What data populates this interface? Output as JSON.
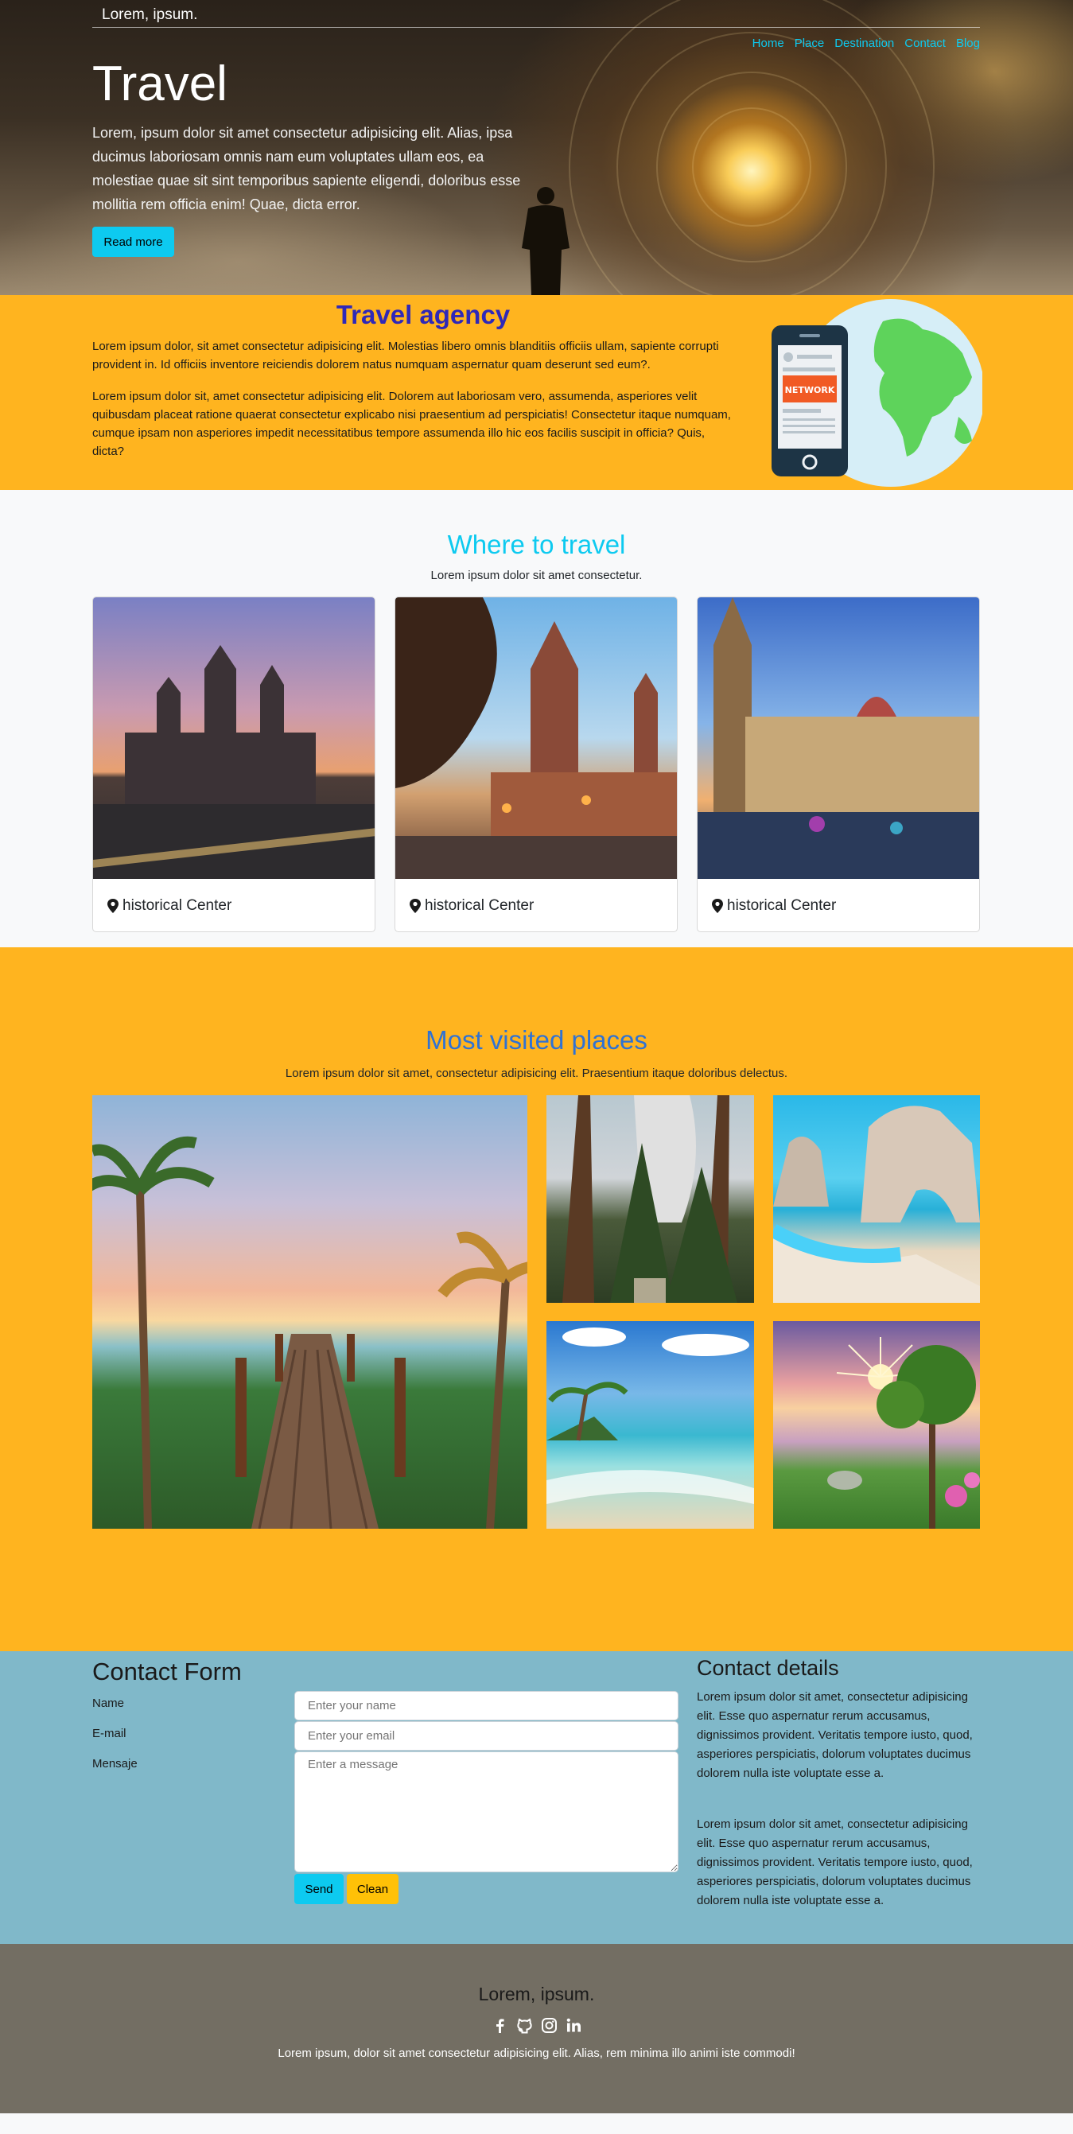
{
  "header": {
    "brand": "Lorem, ipsum.",
    "nav": [
      "Home",
      "Place",
      "Destination",
      "Contact",
      "Blog"
    ]
  },
  "hero": {
    "title": "Travel",
    "text": "Lorem, ipsum dolor sit amet consectetur adipisicing elit. Alias, ipsa ducimus laboriosam omnis nam eum voluptates ullam eos, ea molestiae quae sit sint temporibus sapiente eligendi, doloribus esse mollitia rem officia enim! Quae, dicta error.",
    "button": "Read more"
  },
  "agency": {
    "title": "Travel agency",
    "p1": "Lorem ipsum dolor, sit amet consectetur adipisicing elit. Molestias libero omnis blanditiis officiis ullam, sapiente corrupti provident in. Id officiis inventore reiciendis dolorem natus numquam aspernatur quam deserunt sed eum?.",
    "p2": "Lorem ipsum dolor sit, amet consectetur adipisicing elit. Dolorem aut laboriosam vero, assumenda, asperiores velit quibusdam placeat ratione quaerat consectetur explicabo nisi praesentium ad perspiciatis! Consectetur itaque numquam, cumque ipsam non asperiores impedit necessitatibus tempore assumenda illo hic eos facilis suscipit in officia? Quis, dicta?",
    "image_label": "NETWORK"
  },
  "where": {
    "title": "Where to travel",
    "subtitle": "Lorem ipsum dolor sit amet consectetur.",
    "cards": [
      {
        "caption": "historical Center"
      },
      {
        "caption": "historical Center"
      },
      {
        "caption": "historical Center"
      }
    ]
  },
  "most": {
    "title": "Most visited places",
    "subtitle": "Lorem ipsum dolor sit amet, consectetur adipisicing elit. Praesentium itaque doloribus delectus."
  },
  "contact": {
    "title": "Contact Form",
    "name_label": "Name",
    "email_label": "E-mail",
    "message_label": "Mensaje",
    "name_placeholder": "Enter your name",
    "email_placeholder": "Enter your email",
    "message_placeholder": "Enter a message",
    "send": "Send",
    "clean": "Clean",
    "details_title": "Contact details",
    "d1": "Lorem ipsum dolor sit amet, consectetur adipisicing elit. Esse quo aspernatur rerum accusamus, dignissimos provident. Veritatis tempore iusto, quod, asperiores perspiciatis, dolorum voluptates ducimus dolorem nulla iste voluptate esse a.",
    "d2": "Lorem ipsum dolor sit amet, consectetur adipisicing elit. Esse quo aspernatur rerum accusamus, dignissimos provident. Veritatis tempore iusto, quod, asperiores perspiciatis, dolorum voluptates ducimus dolorem nulla iste voluptate esse a."
  },
  "footer": {
    "brand": "Lorem, ipsum.",
    "social": [
      "facebook-icon",
      "github-icon",
      "instagram-icon",
      "linkedin-icon"
    ],
    "text": "Lorem ipsum, dolor sit amet consectetur adipisicing elit. Alias, rem minima illo animi iste commodi!"
  },
  "colors": {
    "accent": "#0dcaf0",
    "orange": "#ffb41f",
    "contact_bg": "#80b8c9",
    "footer_bg": "#736e63"
  }
}
